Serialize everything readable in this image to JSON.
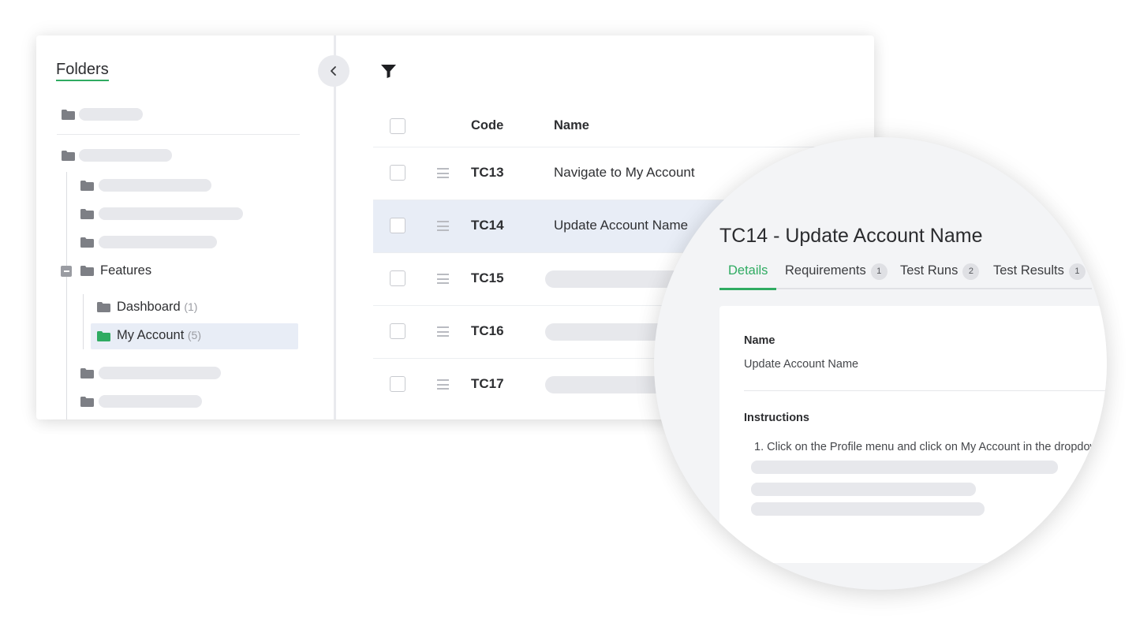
{
  "sidebar": {
    "title": "Folders",
    "collapse_icon": "chevron-left-icon",
    "folders": [
      {
        "label": "Features",
        "expanded": true
      },
      {
        "label": "Dashboard",
        "count": "(1)"
      },
      {
        "label": "My Account",
        "count": "(5)",
        "selected": true
      }
    ]
  },
  "table": {
    "filter_icon": "filter-icon",
    "columns": {
      "code": "Code",
      "name": "Name"
    },
    "rows": [
      {
        "code": "TC13",
        "name": "Navigate to My Account"
      },
      {
        "code": "TC14",
        "name": "Update Account Name",
        "active": true
      },
      {
        "code": "TC15",
        "name": ""
      },
      {
        "code": "TC16",
        "name": ""
      },
      {
        "code": "TC17",
        "name": ""
      }
    ]
  },
  "detail": {
    "title": "TC14 - Update Account Name",
    "tabs": [
      {
        "label": "Details",
        "active": true
      },
      {
        "label": "Requirements",
        "badge": "1"
      },
      {
        "label": "Test Runs",
        "badge": "2"
      },
      {
        "label": "Test Results",
        "badge": "1"
      }
    ],
    "name_label": "Name",
    "name_value": "Update Account Name",
    "instructions_label": "Instructions",
    "instruction_1": "1. Click on the Profile menu and click on My Account in the dropdow"
  },
  "colors": {
    "accent_green": "#2fab62",
    "selected_bg": "#e8edf6",
    "folder_gray": "#7d7f85"
  }
}
